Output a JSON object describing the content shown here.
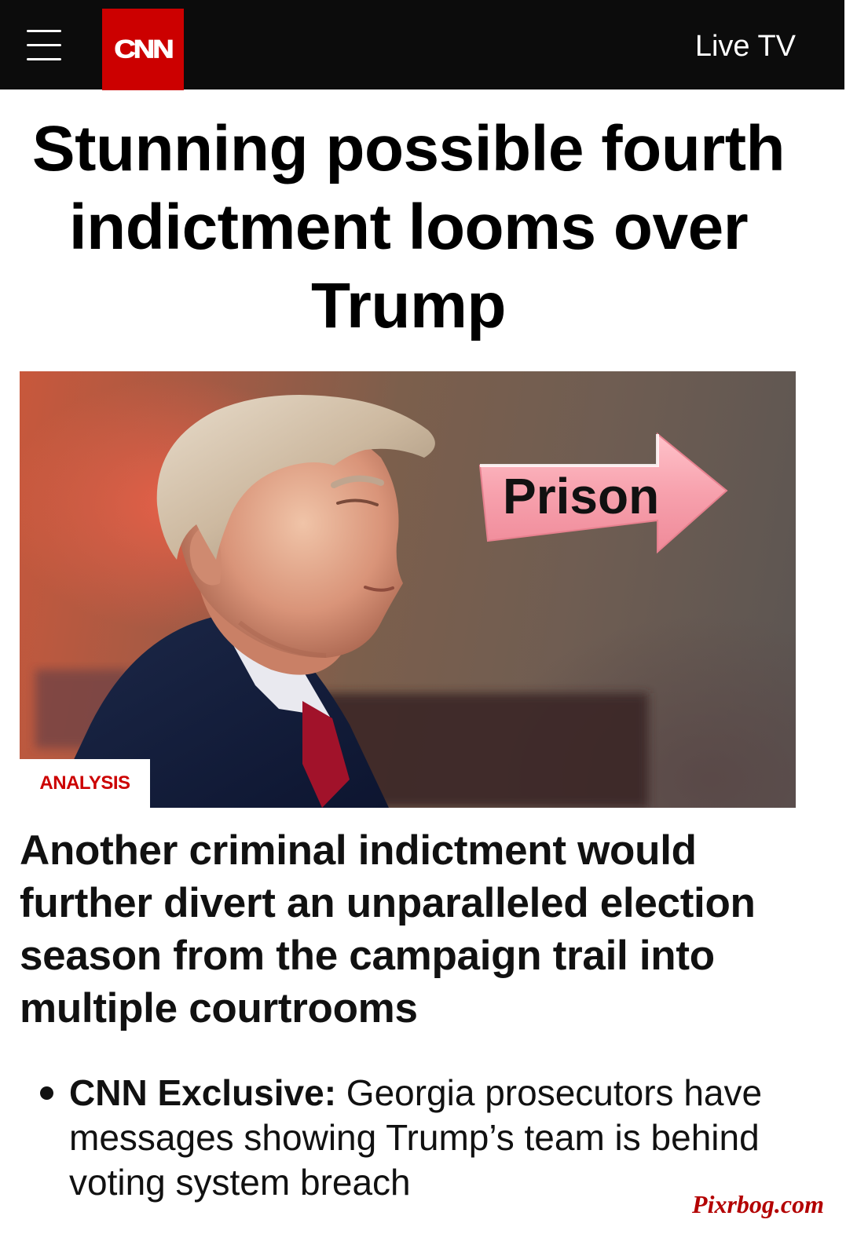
{
  "header": {
    "logo_text": "CNN",
    "live_tv_label": "Live TV"
  },
  "article": {
    "headline": "Stunning possible fourth indictment looms over Trump",
    "image": {
      "overlay_text": "Prison",
      "badge": "ANALYSIS"
    },
    "subheadline": "Another criminal indictment would further divert an unparalleled election season from the campaign trail into multiple courtrooms",
    "bullets": [
      {
        "label": "CNN Exclusive:",
        "text": " Georgia prosecutors have messages showing Trump’s team is behind voting system breach"
      }
    ]
  },
  "watermark": "Pixrbog.com",
  "colors": {
    "brand_red": "#cc0000",
    "nav_bg": "#0c0c0c",
    "arrow_pink": "#f7a1ad"
  }
}
